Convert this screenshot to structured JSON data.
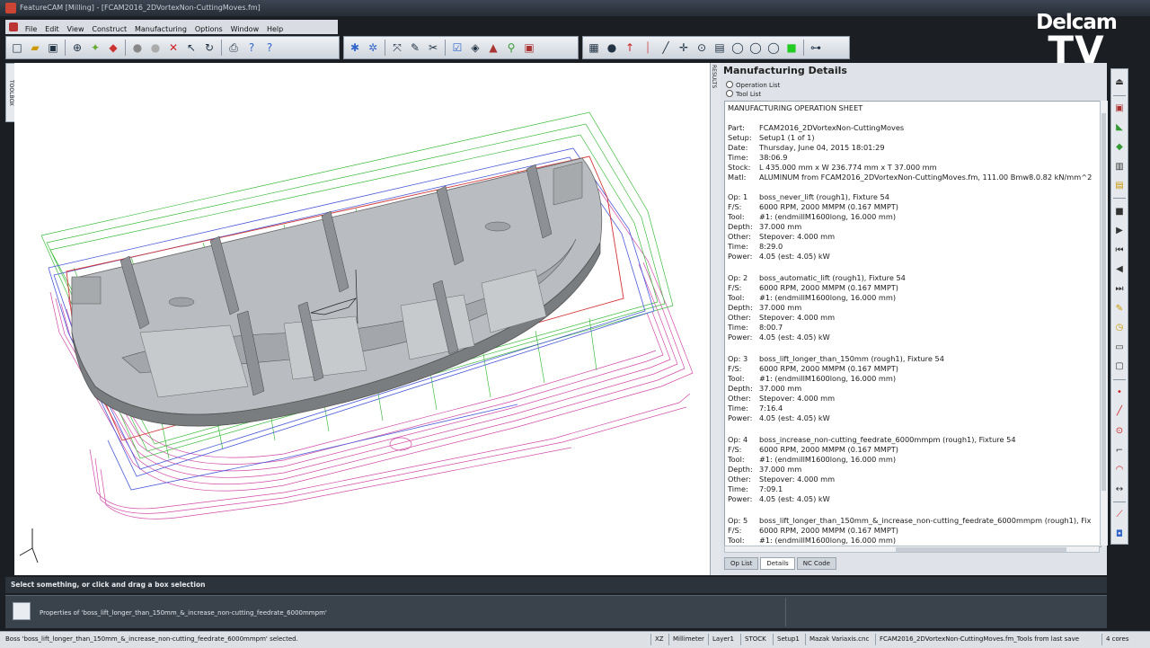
{
  "window": {
    "title": "FeatureCAM  [Milling] - [FCAM2016_2DVortexNon-CuttingMoves.fm]"
  },
  "menu": [
    "File",
    "Edit",
    "View",
    "Construct",
    "Manufacturing",
    "Options",
    "Window",
    "Help"
  ],
  "watermark": {
    "line1": "Delcam",
    "line2": "TV"
  },
  "left_tab": "TOOLBOX",
  "results_tab": "RESULTS",
  "panel": {
    "title": "Manufacturing Details",
    "radio_operation": "Operation List",
    "radio_tool": "Tool List",
    "sheet_heading": "MANUFACTURING OPERATION SHEET",
    "header_rows": [
      {
        "k": "Part:",
        "v": "FCAM2016_2DVortexNon-CuttingMoves"
      },
      {
        "k": "Setup:",
        "v": "Setup1 (1 of 1)"
      },
      {
        "k": "Date:",
        "v": "Thursday, June 04, 2015 18:01:29"
      },
      {
        "k": "Time:",
        "v": "38:06.9"
      },
      {
        "k": "Stock:",
        "v": "L 435.000 mm x W 236.774 mm x T 37.000 mm"
      },
      {
        "k": "Matl:",
        "v": "ALUMINUM from FCAM2016_2DVortexNon-CuttingMoves.fm, 111.00 Bmw8.0.82 kN/mm^2"
      }
    ],
    "ops": [
      {
        "op": "Op: 1",
        "name": "boss_never_lift (rough1), Fixture 54",
        "fs": "6000 RPM, 2000 MMPM (0.167 MMPT)",
        "tool": "#1: (endmillM1600long, 16.000 mm)",
        "depth": "37.000 mm",
        "other": "Stepover: 4.000 mm",
        "time": "8:29.0",
        "power": "4.05 (est: 4.05) kW"
      },
      {
        "op": "Op: 2",
        "name": "boss_automatic_lift (rough1), Fixture 54",
        "fs": "6000 RPM, 2000 MMPM (0.167 MMPT)",
        "tool": "#1: (endmillM1600long, 16.000 mm)",
        "depth": "37.000 mm",
        "other": "Stepover: 4.000 mm",
        "time": "8:00.7",
        "power": "4.05 (est: 4.05) kW"
      },
      {
        "op": "Op: 3",
        "name": "boss_lift_longer_than_150mm (rough1), Fixture 54",
        "fs": "6000 RPM, 2000 MMPM (0.167 MMPT)",
        "tool": "#1: (endmillM1600long, 16.000 mm)",
        "depth": "37.000 mm",
        "other": "Stepover: 4.000 mm",
        "time": "7:16.4",
        "power": "4.05 (est: 4.05) kW"
      },
      {
        "op": "Op: 4",
        "name": "boss_increase_non-cutting_feedrate_6000mmpm (rough1), Fixture 54",
        "fs": "6000 RPM, 2000 MMPM (0.167 MMPT)",
        "tool": "#1: (endmillM1600long, 16.000 mm)",
        "depth": "37.000 mm",
        "other": "Stepover: 4.000 mm",
        "time": "7:09.1",
        "power": "4.05 (est: 4.05) kW"
      },
      {
        "op": "Op: 5",
        "name": "boss_lift_longer_than_150mm_&_increase_non-cutting_feedrate_6000mmpm (rough1), Fix",
        "fs": "6000 RPM, 2000 MMPM (0.167 MMPT)",
        "tool": "#1: (endmillM1600long, 16.000 mm)"
      }
    ],
    "labels": {
      "fs": "F/S:",
      "tool": "Tool:",
      "depth": "Depth:",
      "other": "Other:",
      "time": "Time:",
      "power": "Power:"
    },
    "tabs": [
      "Op List",
      "Details",
      "NC Code"
    ]
  },
  "prompt": "Select something, or click and drag a box selection",
  "properties_text": "Properties of 'boss_lift_longer_than_150mm_&_increase_non-cutting_feedrate_6000mmpm'",
  "status": {
    "selected": "Boss 'boss_lift_longer_than_150mm_&_increase_non-cutting_feedrate_6000mmpm' selected.",
    "plane": "XZ",
    "units": "Millimeter",
    "layer": "Layer1",
    "stock": "STOCK",
    "setup": "Setup1",
    "post": "Mazak Variaxis.cnc",
    "file": "FCAM2016_2DVortexNon-CuttingMoves.fm_Tools from last save",
    "cores": "4 cores"
  }
}
